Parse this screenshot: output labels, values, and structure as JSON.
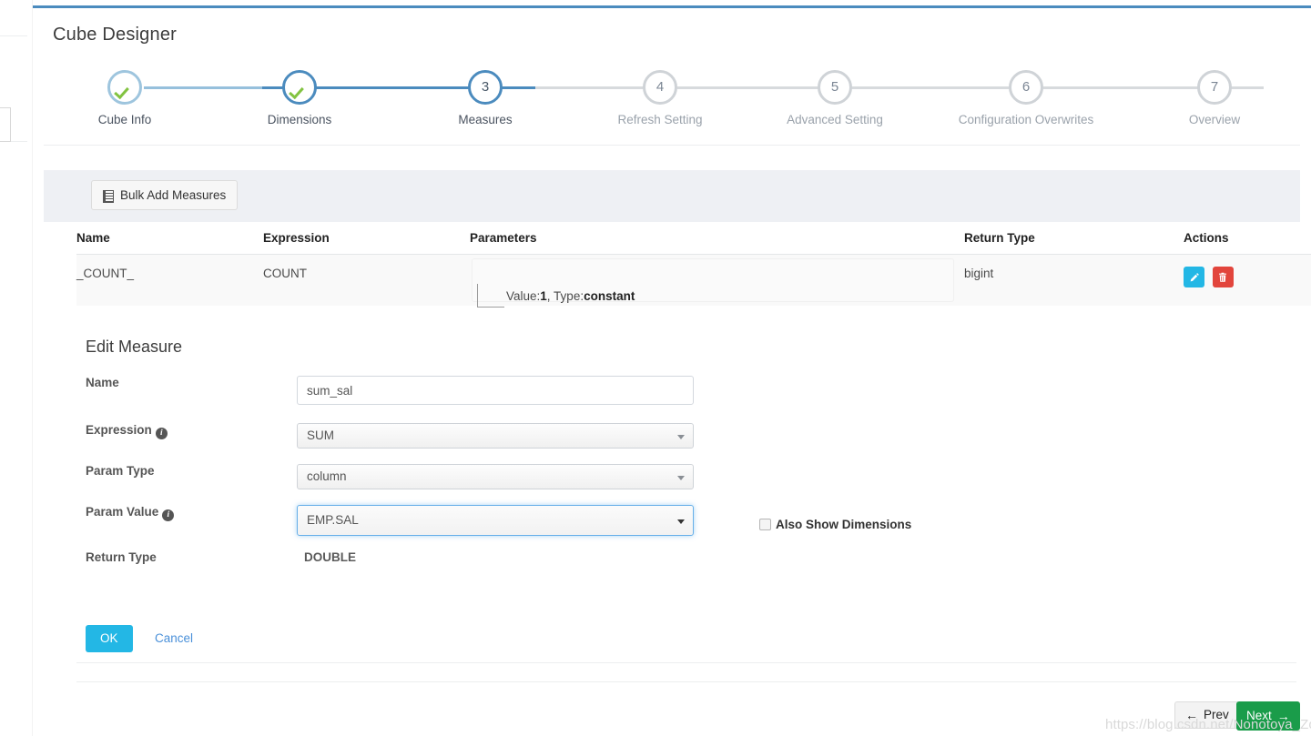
{
  "page": {
    "title": "Cube Designer",
    "watermark": "https://blog.csdn.net/Nonotoya_Zoro"
  },
  "stepper": {
    "steps": [
      {
        "num": "1",
        "label": "Cube Info",
        "state": "done"
      },
      {
        "num": "2",
        "label": "Dimensions",
        "state": "done"
      },
      {
        "num": "3",
        "label": "Measures",
        "state": "current"
      },
      {
        "num": "4",
        "label": "Refresh Setting",
        "state": "upcoming"
      },
      {
        "num": "5",
        "label": "Advanced Setting",
        "state": "upcoming"
      },
      {
        "num": "6",
        "label": "Configuration Overwrites",
        "state": "upcoming"
      },
      {
        "num": "7",
        "label": "Overview",
        "state": "upcoming"
      }
    ]
  },
  "toolbar": {
    "bulk_add_label": "Bulk Add Measures",
    "bulk_add_icon": "list-document-icon"
  },
  "measures_table": {
    "headers": {
      "name": "Name",
      "expression": "Expression",
      "parameters": "Parameters",
      "return_type": "Return Type",
      "actions": "Actions"
    },
    "rows": [
      {
        "name": "_COUNT_",
        "expression": "COUNT",
        "param_prefix": "Value:",
        "param_value": "1",
        "param_mid": ", Type:",
        "param_type": "constant",
        "return_type": "bigint",
        "edit_icon": "pencil-icon",
        "delete_icon": "trash-icon"
      }
    ]
  },
  "edit_measure": {
    "heading": "Edit Measure",
    "fields": {
      "name_label": "Name",
      "name_value": "sum_sal",
      "name_placeholder": "",
      "expression_label": "Expression",
      "expression_value": "SUM",
      "param_type_label": "Param Type",
      "param_type_value": "column",
      "param_value_label": "Param Value",
      "param_value_value": "EMP.SAL",
      "return_type_label": "Return Type",
      "return_type_value": "DOUBLE"
    },
    "checkbox": {
      "label": "Also Show Dimensions",
      "checked": false
    },
    "actions": {
      "ok_label": "OK",
      "cancel_label": "Cancel"
    }
  },
  "footer": {
    "prev_label": "Prev",
    "next_label": "Next",
    "prev_icon": "arrow-left-icon",
    "next_icon": "arrow-right-icon"
  },
  "colors": {
    "accent_blue": "#4b8bbe",
    "check_green": "#82c341",
    "edit_cyan": "#23b7e5",
    "delete_red": "#e2453c",
    "next_green": "#1a9c4a",
    "focus_blue": "#66afe9"
  }
}
